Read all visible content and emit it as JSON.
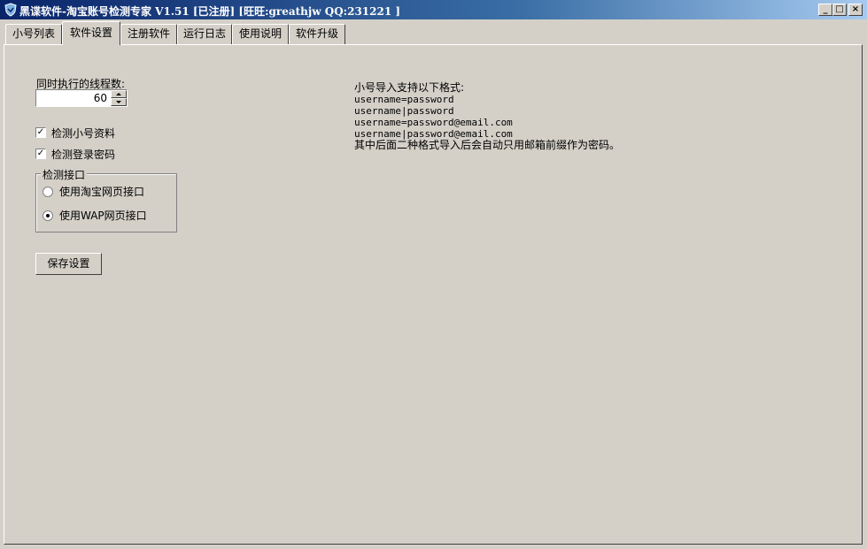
{
  "window": {
    "title": "黑谍软件-淘宝账号检测专家 V1.51 [已注册] [旺旺:greathjw QQ:231221 ]",
    "controls": {
      "minimize": "_",
      "maximize": "□",
      "close": "×"
    }
  },
  "tabs": [
    "小号列表",
    "软件设置",
    "注册软件",
    "运行日志",
    "使用说明",
    "软件升级"
  ],
  "settings": {
    "threads_label": "同时执行的线程数:",
    "threads_value": "60",
    "check_account_info": "检测小号资料",
    "check_login_password": "检测登录密码",
    "interface_group": "检测接口",
    "interface_taobao_web": "使用淘宝网页接口",
    "interface_wap_web": "使用WAP网页接口",
    "save_button": "保存设置"
  },
  "info": {
    "heading": "小号导入支持以下格式:",
    "formats": [
      "username=password",
      "username|password",
      "username=password@email.com",
      "username|password@email.com"
    ],
    "note": "其中后面二种格式导入后会自动只用邮箱前缀作为密码。"
  },
  "icons": {
    "app": "app-shield-icon",
    "checkbox_mark": "✓",
    "spin_up": "▲",
    "spin_down": "▼"
  },
  "colors": {
    "titlebar_start": "#0a246a",
    "titlebar_end": "#a6caf0",
    "face": "#d4d0c8"
  }
}
